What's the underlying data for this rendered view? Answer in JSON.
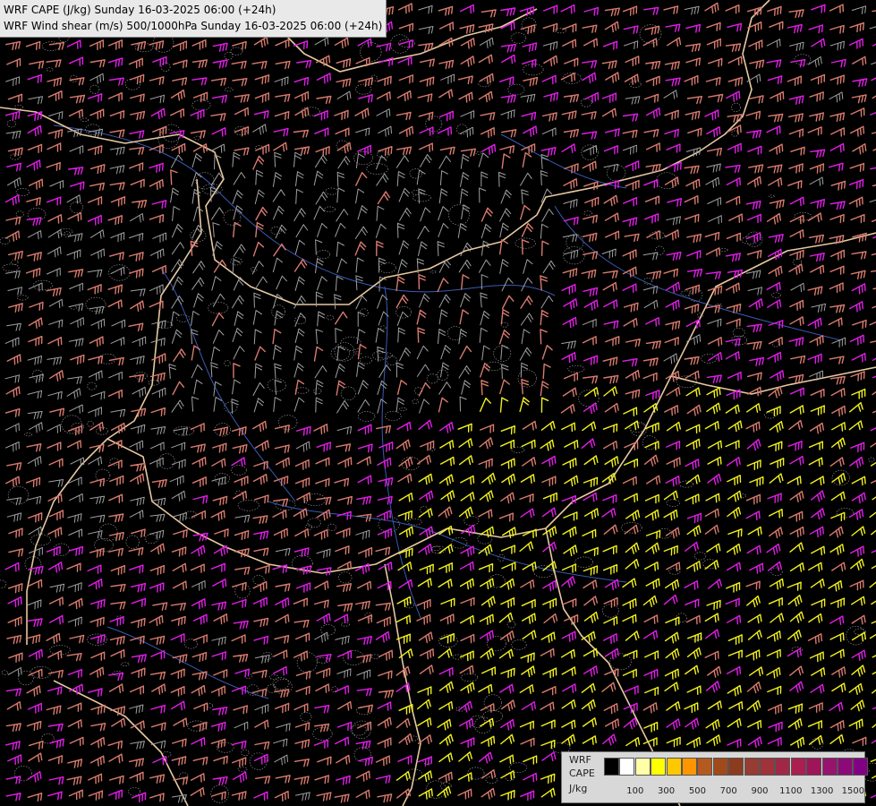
{
  "header": {
    "line1": "WRF CAPE (J/kg) Sunday 16-03-2025 06:00 (+24h)",
    "line2": "WRF Wind shear (m/s) 500/1000hPa Sunday 16-03-2025 06:00 (+24h)"
  },
  "legend": {
    "label1": "WRF",
    "label2": "CAPE",
    "label3": "J/kg",
    "colors": [
      "#000000",
      "#ffffff",
      "#ffffa8",
      "#ffff00",
      "#ffc800",
      "#ff9600",
      "#b45a1e",
      "#a04a1c",
      "#8c3c1e",
      "#963c32",
      "#a0323c",
      "#a02846",
      "#aa1e50",
      "#a0145a",
      "#96146e",
      "#8c0a78",
      "#820082"
    ],
    "ticks": [
      "100",
      "300",
      "500",
      "700",
      "900",
      "1100",
      "1300",
      "1500"
    ]
  },
  "palette": {
    "background": "#000000",
    "barb_grey": "#a0a0a0",
    "barb_salmon": "#d77a6e",
    "barb_magenta": "#e01ee6",
    "barb_yellow": "#f0f020",
    "border_beige": "#e6c8a0",
    "river_blue": "#3c5ab4",
    "terrain_grey": "#8c8c8c"
  }
}
